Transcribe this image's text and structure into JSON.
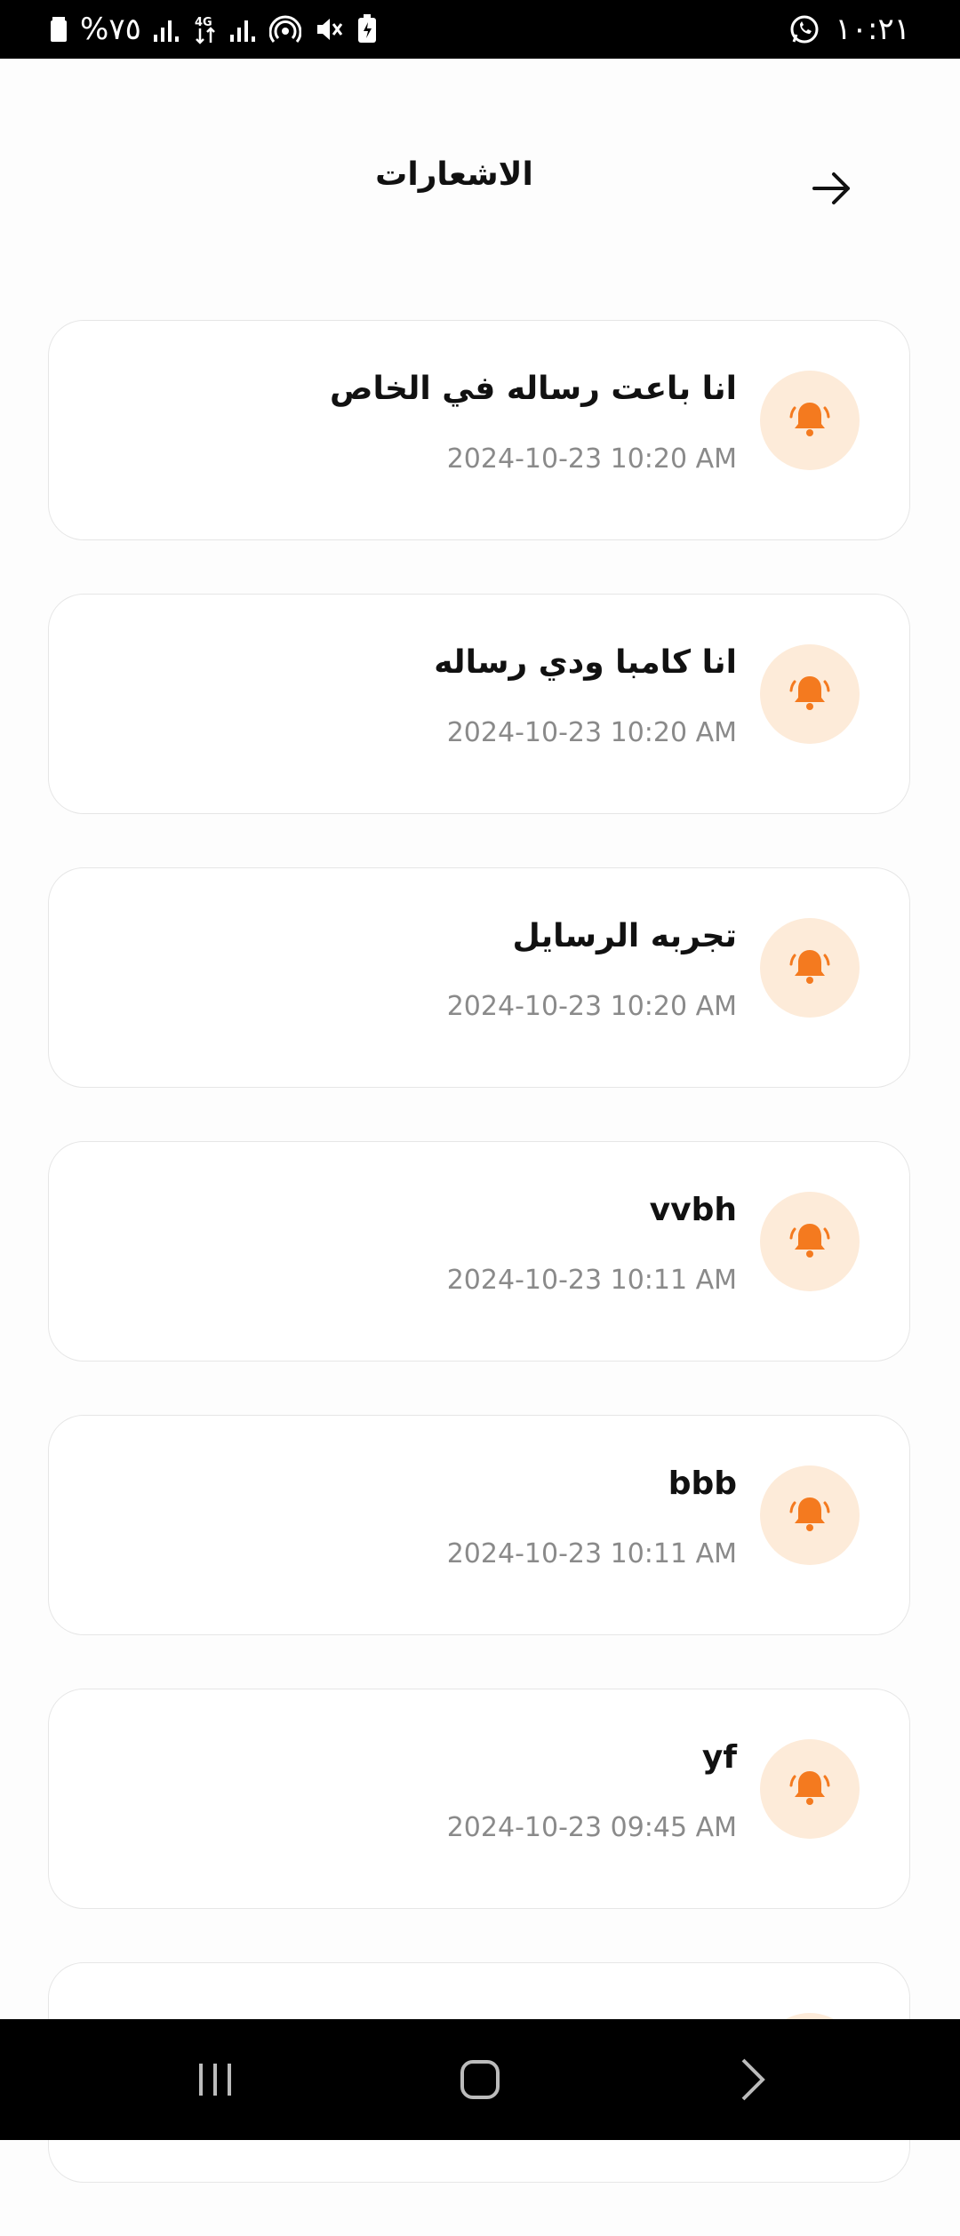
{
  "status_bar": {
    "battery": "%٧٥",
    "time": "١٠:٢١"
  },
  "header": {
    "title": "الاشعارات"
  },
  "notifications": [
    {
      "title": "انا باعت رساله في الخاص",
      "time": "2024-10-23 10:20 AM"
    },
    {
      "title": "انا كامبا ودي رساله",
      "time": "2024-10-23 10:20 AM"
    },
    {
      "title": "تجربه الرسايل",
      "time": "2024-10-23 10:20 AM"
    },
    {
      "title": "vvbh",
      "time": "2024-10-23 10:11 AM"
    },
    {
      "title": "bbb",
      "time": "2024-10-23 10:11 AM"
    },
    {
      "title": "yf",
      "time": "2024-10-23 09:45 AM"
    },
    {
      "title": "",
      "time": ""
    }
  ],
  "colors": {
    "accent": "#f47a1f",
    "bell_bg": "#fdebd9",
    "card_border": "#e6e6e6",
    "time_text": "#8a8a8a"
  },
  "icons": {
    "back": "arrow-right-icon",
    "notification": "bell-ringing-icon"
  }
}
